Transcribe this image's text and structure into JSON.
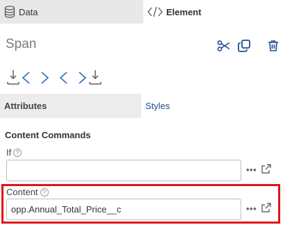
{
  "top_tabs": {
    "data_label": "Data",
    "element_label": "Element"
  },
  "header": {
    "title": "Span"
  },
  "sub_tabs": {
    "attributes_label": "Attributes",
    "styles_label": "Styles"
  },
  "section": {
    "title": "Content Commands"
  },
  "fields": {
    "if_label": "If",
    "if_value": "",
    "content_label": "Content",
    "content_value": "opp.Annual_Total_Price__c",
    "more_label": "•••"
  },
  "colors": {
    "highlight": "#e0141b",
    "link_blue": "#1f4f8e",
    "active_tab_bg": "#e8e8e8"
  }
}
